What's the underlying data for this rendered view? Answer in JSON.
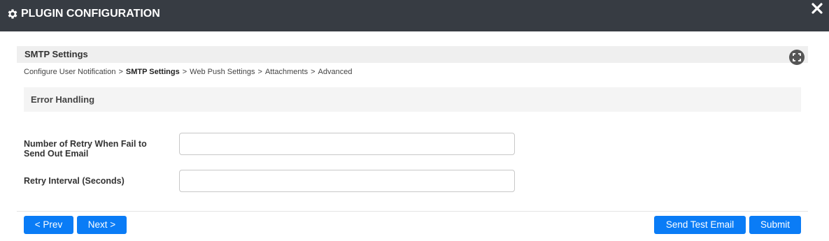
{
  "dialog": {
    "title": "PLUGIN CONFIGURATION"
  },
  "section": {
    "title": "SMTP Settings"
  },
  "breadcrumb": {
    "items": [
      {
        "label": "Configure User Notification",
        "active": false
      },
      {
        "label": "SMTP Settings",
        "active": true
      },
      {
        "label": "Web Push Settings",
        "active": false
      },
      {
        "label": "Attachments",
        "active": false
      },
      {
        "label": "Advanced",
        "active": false
      }
    ],
    "separator": ">"
  },
  "subsection": {
    "title": "Error Handling"
  },
  "form": {
    "retry_count": {
      "label_line1": "Number of Retry When Fail to",
      "label_line2": "Send Out Email",
      "value": ""
    },
    "retry_interval": {
      "label": "Retry Interval (Seconds)",
      "value": ""
    }
  },
  "buttons": {
    "prev": "< Prev",
    "next": "Next >",
    "send_test": "Send Test Email",
    "submit": "Submit"
  },
  "icons": {
    "header": "gear-icon",
    "close": "close-icon",
    "expand": "expand-icon"
  },
  "colors": {
    "titlebar": "#373c43",
    "primary_button": "#0a7cf6",
    "section_bg": "#efefef"
  }
}
